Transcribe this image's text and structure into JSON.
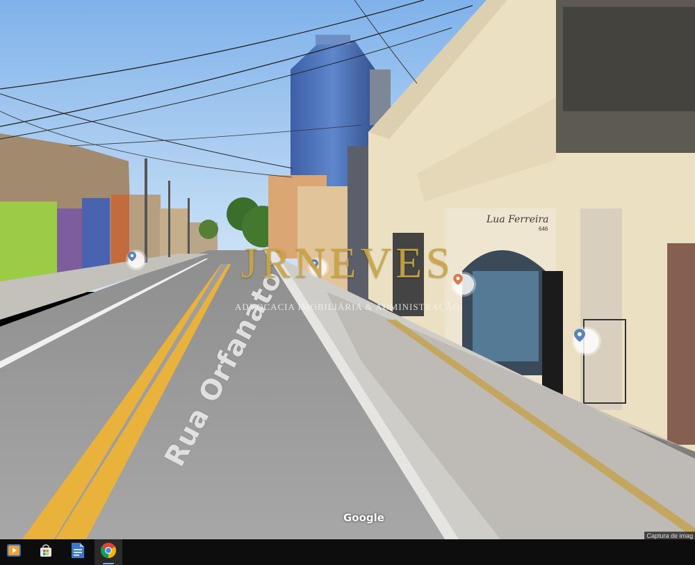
{
  "street_view": {
    "road_name": "Rua Orfanato",
    "shop_sign": "Lua Ferreira",
    "building_number": "646",
    "provider_logo": "Google",
    "capture_label": "Captura de imag"
  },
  "watermark": {
    "title": "JRNEVES",
    "subtitle": "ADVOCACIA IMOBILIÁRIA & ADMINISTRAÇÃO",
    "color": "#c9a440"
  },
  "markers": [
    {
      "name": "location-pin-icon",
      "color": "#5a84b8"
    },
    {
      "name": "location-pin-icon",
      "color": "#5a84b8"
    },
    {
      "name": "location-pin-icon",
      "color": "#e0784a"
    },
    {
      "name": "location-pin-icon",
      "color": "#5a84b8"
    }
  ],
  "taskbar": {
    "icons": [
      {
        "name": "media-player-icon"
      },
      {
        "name": "store-icon"
      },
      {
        "name": "document-icon"
      },
      {
        "name": "chrome-icon",
        "active": true
      }
    ]
  }
}
